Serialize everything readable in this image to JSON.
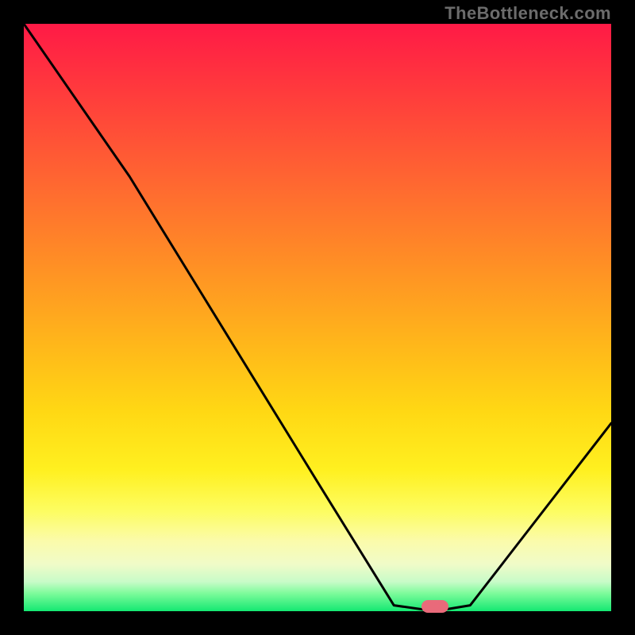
{
  "watermark": "TheBottleneck.com",
  "chart_data": {
    "type": "line",
    "title": "",
    "xlabel": "",
    "ylabel": "",
    "xlim": [
      0,
      100
    ],
    "ylim": [
      0,
      100
    ],
    "x": [
      0,
      18,
      50,
      63,
      70,
      76,
      100
    ],
    "values": [
      100,
      74,
      22,
      1,
      0,
      1,
      32
    ],
    "marker": {
      "x": 70,
      "y": 0.8
    },
    "background_gradient": {
      "top": "#ff1a46",
      "mid": "#ffd814",
      "bottom": "#14e872"
    }
  }
}
